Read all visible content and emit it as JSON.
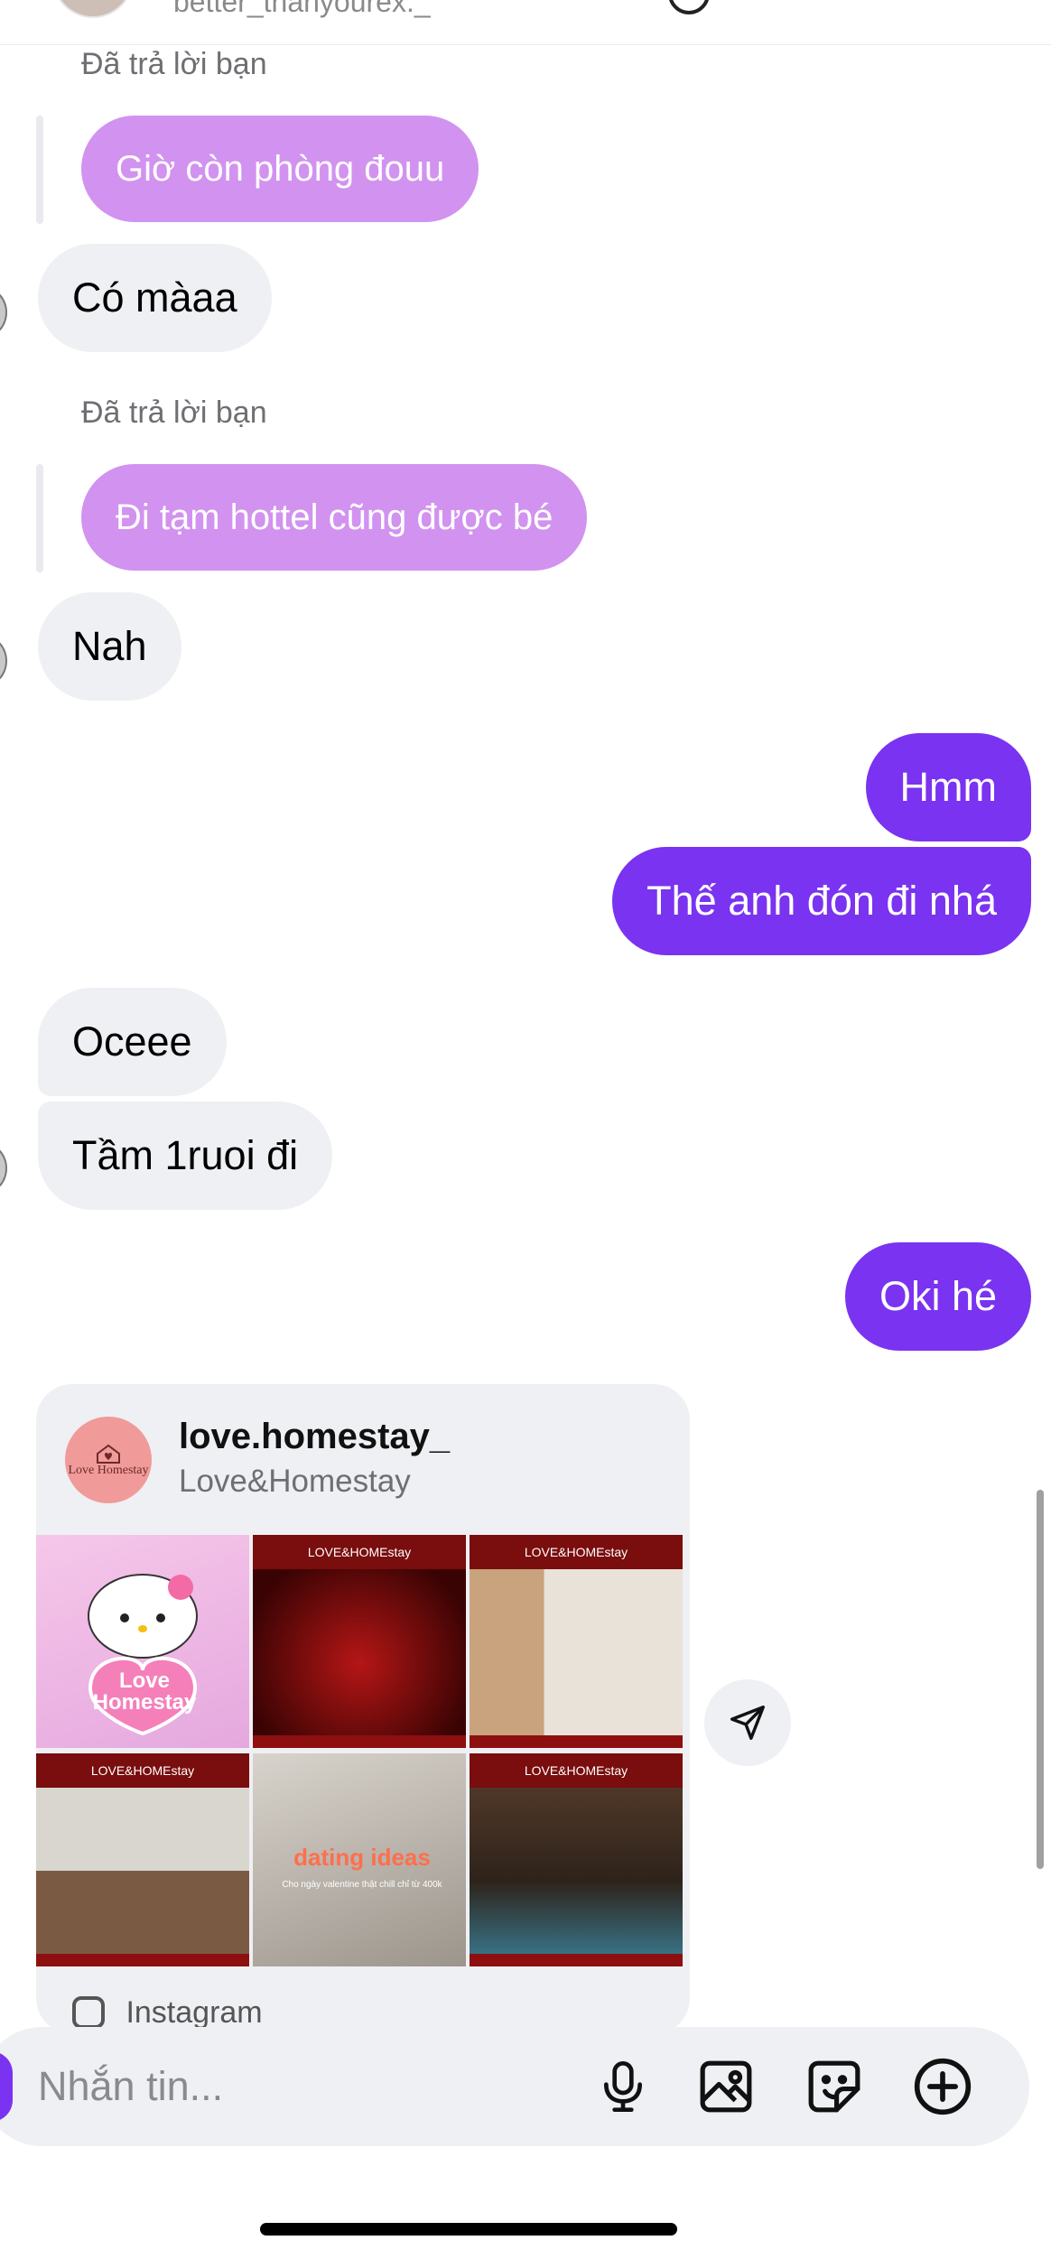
{
  "header": {
    "username": "better_thanyourex._"
  },
  "messages": [
    {
      "type": "reply",
      "label": "Đã trả lời bạn",
      "text": "Giờ còn phòng đouu"
    },
    {
      "type": "incoming",
      "text": "Có màaa"
    },
    {
      "type": "reply",
      "label": "Đã trả lời bạn",
      "text": "Đi tạm hottel cũng được bé"
    },
    {
      "type": "incoming",
      "text": "Nah"
    },
    {
      "type": "outgoing",
      "text": "Hmm"
    },
    {
      "type": "outgoing",
      "text": "Thế anh đón đi nhá"
    },
    {
      "type": "incoming",
      "text": "Oceee"
    },
    {
      "type": "incoming",
      "text": "Tầm 1ruoi đi"
    },
    {
      "type": "outgoing",
      "text": "Oki hé"
    }
  ],
  "post": {
    "username": "love.homestay_",
    "display_name": "Love&Homestay",
    "avatar_text": "Love Homestay",
    "tiles": [
      {
        "label": "",
        "title": "Love Homestay"
      },
      {
        "label": "LOVE&HOMEstay"
      },
      {
        "label": "LOVE&HOMEstay"
      },
      {
        "label": "LOVE&HOMEstay"
      },
      {
        "label": "",
        "title": "dating ideas",
        "subtitle": "Cho ngày valentine thật chill chỉ từ 400k"
      },
      {
        "label": "LOVE&HOMEstay"
      }
    ],
    "source": "Instagram"
  },
  "composer": {
    "placeholder": "Nhắn tin..."
  },
  "icons": {
    "share": "send-icon",
    "mic": "microphone-icon",
    "gallery": "image-icon",
    "sticker": "sticker-icon",
    "add": "plus-circle-icon"
  },
  "colors": {
    "outgoing_bubble": "#7a33f0",
    "reply_bubble": "#d193ef",
    "incoming_bubble": "#eff0f3"
  }
}
